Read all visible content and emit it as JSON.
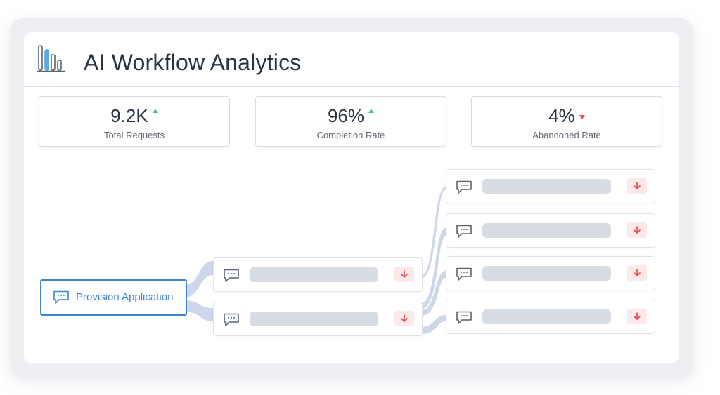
{
  "header": {
    "title": "AI Workflow Analytics",
    "logo_icon": "bar-chart-icon"
  },
  "stats": [
    {
      "value": "9.2K",
      "label": "Total Requests",
      "trend": "up",
      "trend_color": "#3cc59b"
    },
    {
      "value": "96%",
      "label": "Completion Rate",
      "trend": "up",
      "trend_color": "#3cc59b"
    },
    {
      "value": "4%",
      "label": "Abandoned Rate",
      "trend": "down",
      "trend_color": "#ef4d57"
    }
  ],
  "flow": {
    "source": {
      "label": "Provision Application",
      "icon": "chat-bubble-icon",
      "accent": "#3d85cf"
    },
    "level2": [
      {
        "icon": "chat-bubble-icon",
        "action_icon": "arrow-down-icon"
      },
      {
        "icon": "chat-bubble-icon",
        "action_icon": "arrow-down-icon"
      }
    ],
    "level3": [
      {
        "icon": "chat-bubble-icon",
        "action_icon": "arrow-down-icon"
      },
      {
        "icon": "chat-bubble-icon",
        "action_icon": "arrow-down-icon"
      },
      {
        "icon": "chat-bubble-icon",
        "action_icon": "arrow-down-icon"
      },
      {
        "icon": "chat-bubble-icon",
        "action_icon": "arrow-down-icon"
      }
    ],
    "link_color": "#ccd5e8"
  }
}
